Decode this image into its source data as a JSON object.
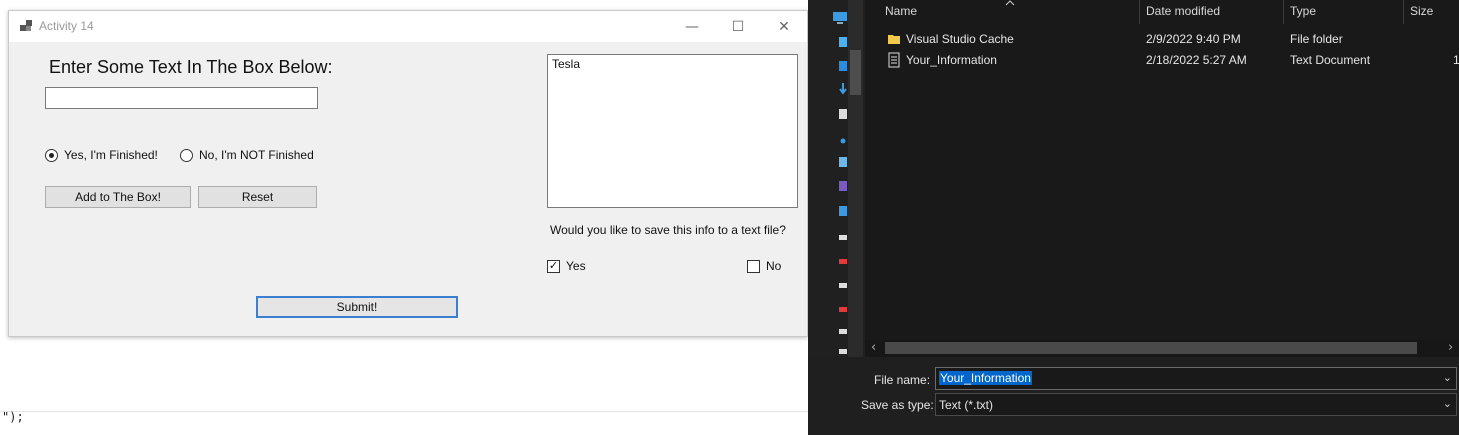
{
  "background_editor": {
    "code_text": "\");"
  },
  "form_window": {
    "title": "Activity 14",
    "caption_buttons": {
      "minimize": "—",
      "maximize": "☐",
      "close": "✕"
    },
    "prompt_label": "Enter Some Text In The Box Below:",
    "text_input": {
      "value": ""
    },
    "radio_yes": {
      "label": "Yes, I'm Finished!",
      "checked": true
    },
    "radio_no": {
      "label": "No, I'm NOT Finished",
      "checked": false
    },
    "add_button": "Add to The Box!",
    "reset_button": "Reset",
    "submit_button": "Submit!",
    "output_box_text": "Tesla",
    "save_question": "Would you like to save this info to a text file?",
    "check_yes": {
      "label": "Yes",
      "checked": true,
      "mark": "✓"
    },
    "check_no": {
      "label": "No",
      "checked": false
    }
  },
  "save_dialog": {
    "columns": {
      "name": "Name",
      "date": "Date modified",
      "type": "Type",
      "size": "Size"
    },
    "files": [
      {
        "icon": "folder-icon",
        "name": "Visual Studio Cache",
        "date": "2/9/2022 9:40 PM",
        "type": "File folder",
        "size": ""
      },
      {
        "icon": "text-file-icon",
        "name": "Your_Information",
        "date": "2/18/2022 5:27 AM",
        "type": "Text Document",
        "size": "1"
      }
    ],
    "file_name_label": "File name:",
    "file_name_value": "Your_Information",
    "save_type_label": "Save as type:",
    "save_type_value": "Text (*.txt)",
    "scroll_left": "‹",
    "scroll_right": "›",
    "dropdown_arrow": "⌄",
    "colors": {
      "folder": "#f2c94c",
      "selection": "#0066cc"
    }
  }
}
